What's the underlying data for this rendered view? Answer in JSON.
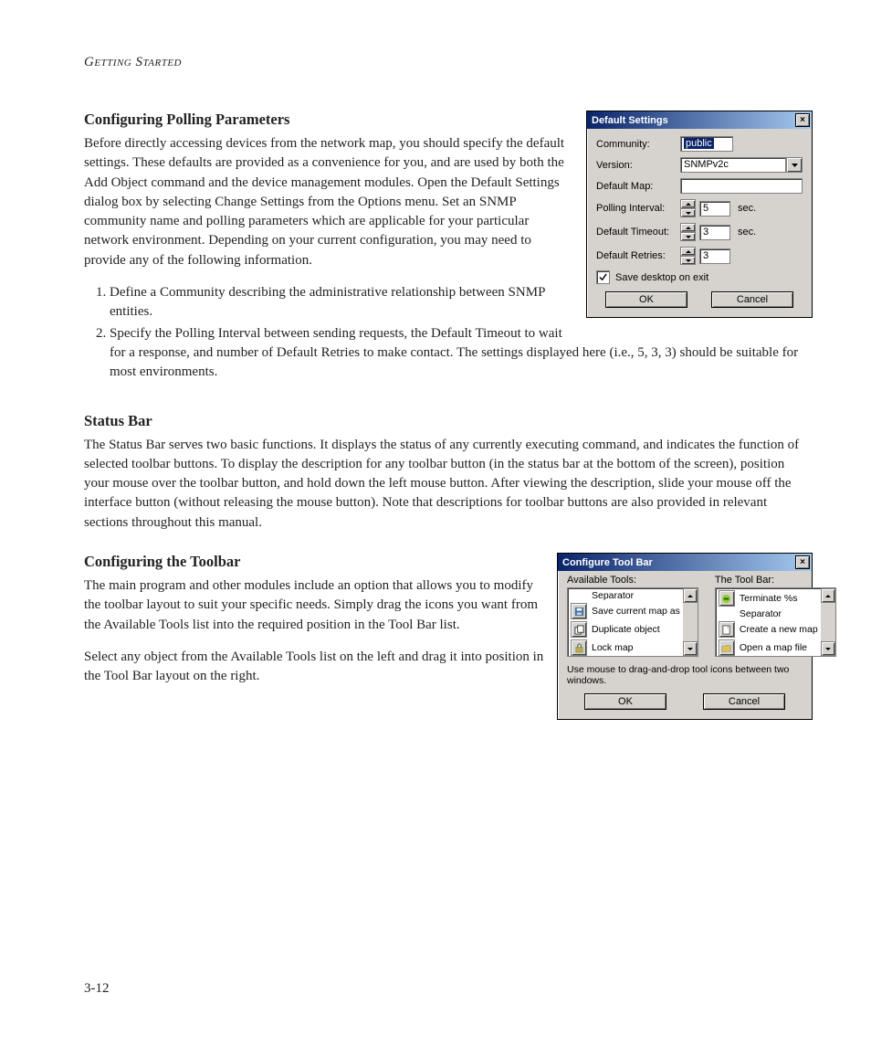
{
  "running_head": "Getting Started",
  "page_number": "3-12",
  "sections": {
    "polling": {
      "heading": "Configuring Polling Parameters",
      "para": "Before directly accessing devices from the network map, you should specify the default settings. These defaults are provided as a convenience for you, and are used by both the Add Object command and the device management modules. Open the Default Settings dialog box by selecting Change Settings from the Options menu. Set an SNMP community name and polling parameters which are applicable for your particular network environment. Depending on your current configuration, you may need to provide any of the following information.",
      "steps": [
        "Define a Community describing the administrative relationship between SNMP entities.",
        "Specify the Polling Interval between sending requests, the Default Timeout to wait for a response, and number of Default Retries to make contact. The settings displayed here (i.e., 5, 3, 3) should be suitable for most environments."
      ]
    },
    "status": {
      "heading": "Status Bar",
      "para": "The Status Bar serves two basic functions. It displays the status of any currently executing command, and indicates the function of selected toolbar buttons. To display the description for any toolbar button (in the status bar at the bottom of the screen), position your mouse over the toolbar button, and hold down the left mouse button. After viewing the description, slide your mouse off the interface button (without releasing the mouse button). Note that descriptions for toolbar buttons are also provided in relevant sections throughout this manual."
    },
    "toolbar": {
      "heading": "Configuring the Toolbar",
      "para1": "The main program and other modules include an option that allows you to modify the toolbar layout to suit your specific needs. Simply drag the icons you want from the Available Tools list into the required position in the Tool Bar list.",
      "para2": "Select any object from the Available Tools list on the left and drag it into position in the Tool Bar layout on the right."
    }
  },
  "dlg_default": {
    "title": "Default Settings",
    "labels": {
      "community": "Community:",
      "version": "Version:",
      "default_map": "Default Map:",
      "polling_interval": "Polling Interval:",
      "default_timeout": "Default Timeout:",
      "default_retries": "Default Retries:"
    },
    "values": {
      "community": "public",
      "version": "SNMPv2c",
      "default_map": "",
      "polling_interval": "5",
      "default_timeout": "3",
      "default_retries": "3"
    },
    "units": {
      "sec": "sec."
    },
    "checkbox": {
      "label": "Save desktop on exit",
      "checked": true
    },
    "buttons": {
      "ok": "OK",
      "cancel": "Cancel"
    }
  },
  "dlg_toolbar": {
    "title": "Configure Tool Bar",
    "available_title": "Available Tools:",
    "toolbar_title": "The Tool Bar:",
    "available_items": [
      {
        "icon": "separator-icon",
        "label": "Separator"
      },
      {
        "icon": "save-map-icon",
        "label": "Save current map as"
      },
      {
        "icon": "duplicate-icon",
        "label": "Duplicate object"
      },
      {
        "icon": "lock-icon",
        "label": "Lock map"
      }
    ],
    "toolbar_items": [
      {
        "icon": "terminate-icon",
        "label": "Terminate %s"
      },
      {
        "icon": "separator-icon",
        "label": "Separator"
      },
      {
        "icon": "new-map-icon",
        "label": "Create a new map"
      },
      {
        "icon": "open-map-icon",
        "label": "Open a map file"
      }
    ],
    "hint": "Use mouse to drag-and-drop tool icons between two windows.",
    "buttons": {
      "ok": "OK",
      "cancel": "Cancel"
    }
  }
}
